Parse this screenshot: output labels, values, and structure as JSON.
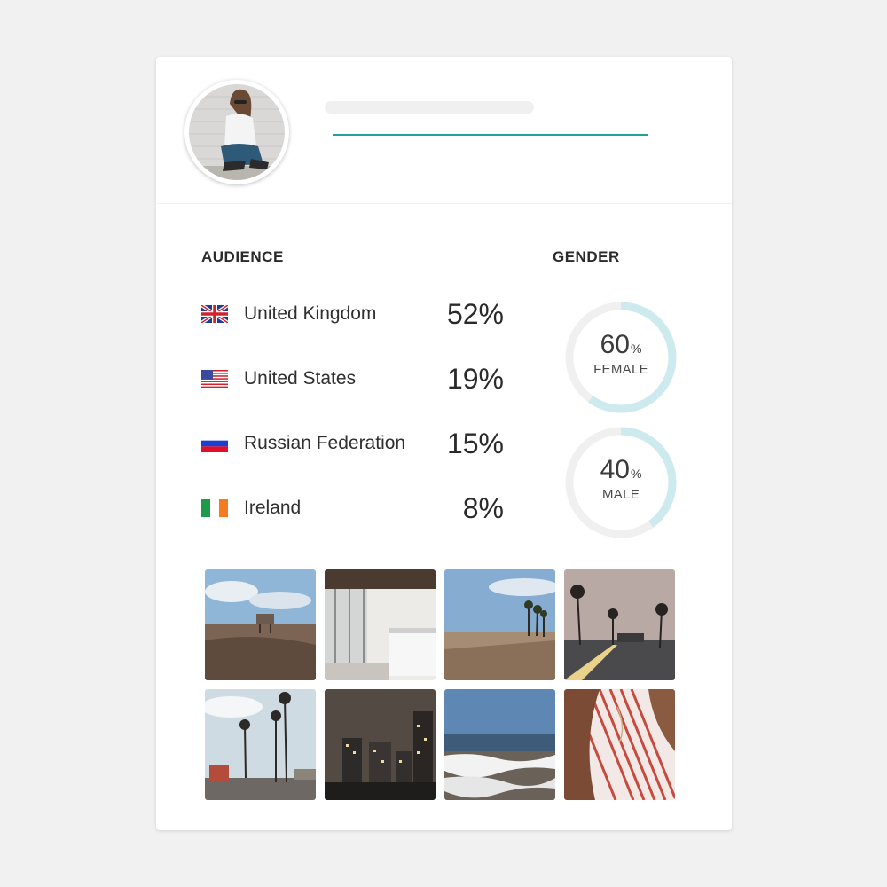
{
  "profile": {
    "avatar_alt": "profile-photo"
  },
  "audience": {
    "title": "AUDIENCE",
    "rows": [
      {
        "flag": "uk-flag",
        "country": "United Kingdom",
        "percent": "52%"
      },
      {
        "flag": "us-flag",
        "country": "United States",
        "percent": "19%"
      },
      {
        "flag": "russia-flag",
        "country": "Russian Federation",
        "percent": "15%"
      },
      {
        "flag": "ireland-flag",
        "country": "Ireland",
        "percent": "8%"
      }
    ]
  },
  "gender": {
    "title": "GENDER",
    "female": {
      "value": "60",
      "unit": "%",
      "label": "FEMALE",
      "fraction": 0.6
    },
    "male": {
      "value": "40",
      "unit": "%",
      "label": "MALE",
      "fraction": 0.4
    },
    "ring_color": "#cdeaee",
    "track_color": "#f0f0f0"
  },
  "colors": {
    "accent": "#23a29a",
    "background": "#f1f1f2",
    "card": "#ffffff"
  },
  "gallery": {
    "photos": [
      "beach-lifeguard-tower-photo",
      "cafe-interior-photo",
      "beach-palm-trees-photo",
      "palm-street-road-photo",
      "palm-tree-avenue-photo",
      "city-skyline-night-photo",
      "ocean-waves-photo",
      "striped-shirt-hair-photo"
    ]
  }
}
